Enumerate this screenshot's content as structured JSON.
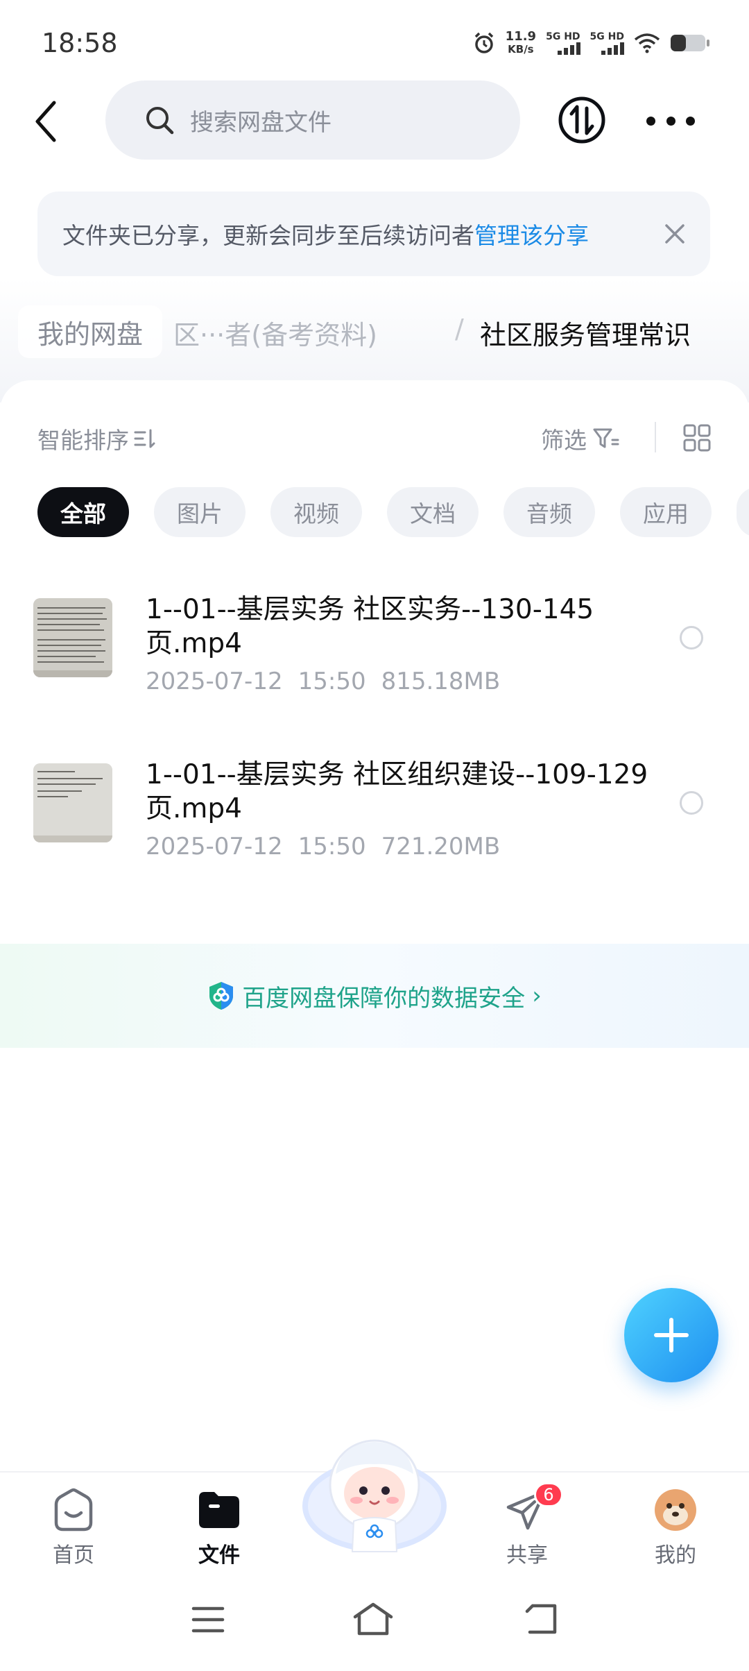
{
  "status_bar": {
    "time": "18:58",
    "net_speed_value": "11.9",
    "net_speed_unit": "KB/s",
    "sim1_label": "5G HD",
    "sim2_label": "5G HD",
    "icons": [
      "alarm-icon",
      "signal-icon",
      "wifi-icon",
      "battery-icon"
    ]
  },
  "top_bar": {
    "search_placeholder": "搜索网盘文件",
    "icons": [
      "back-arrow-icon",
      "search-icon",
      "transfer-icon",
      "more-icon"
    ]
  },
  "share_banner": {
    "text": "文件夹已分享，更新会同步至后续访问者",
    "link": "管理该分享"
  },
  "breadcrumb": {
    "root": "我的网盘",
    "middle": "区···者(备考资料)",
    "separator": "/",
    "current": "社区服务管理常识"
  },
  "toolbar": {
    "sort_label": "智能排序",
    "filter_label": "筛选"
  },
  "tabs": [
    {
      "label": "全部",
      "active": true
    },
    {
      "label": "图片",
      "active": false
    },
    {
      "label": "视频",
      "active": false
    },
    {
      "label": "文档",
      "active": false
    },
    {
      "label": "音频",
      "active": false
    },
    {
      "label": "应用",
      "active": false
    }
  ],
  "files": [
    {
      "name": "1--01--基层实务 社区实务--130-145页.mp4",
      "date": "2025-07-12",
      "time": "15:50",
      "size": "815.18MB"
    },
    {
      "name": "1--01--基层实务 社区组织建设--109-129页.mp4",
      "date": "2025-07-12",
      "time": "15:50",
      "size": "721.20MB"
    }
  ],
  "security": {
    "text": "百度网盘保障你的数据安全"
  },
  "bottom_nav": {
    "items": [
      {
        "label": "首页",
        "icon": "home-icon",
        "active": false
      },
      {
        "label": "文件",
        "icon": "folder-icon",
        "active": true
      },
      {
        "label": "共享",
        "icon": "share-plane-icon",
        "active": false,
        "badge": "6"
      },
      {
        "label": "我的",
        "icon": "avatar-icon",
        "active": false
      }
    ]
  },
  "colors": {
    "accent_blue": "#1a8ae6",
    "security_green": "#1fa38a",
    "badge_red": "#ff3b4f",
    "active_tab": "#0d0f14"
  }
}
